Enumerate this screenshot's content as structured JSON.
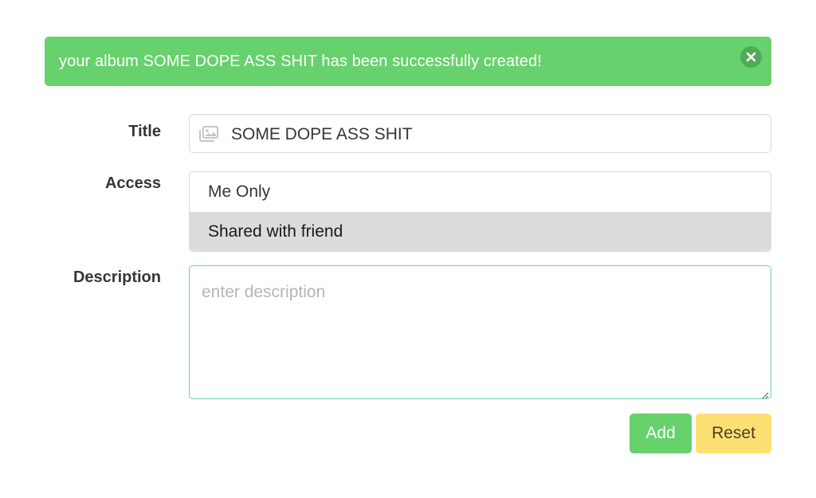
{
  "notification": {
    "message": "your album SOME DOPE ASS SHIT has been successfully created!",
    "close_icon": "close-icon",
    "color": "#67d16d"
  },
  "form": {
    "title": {
      "label": "Title",
      "value": "SOME DOPE ASS SHIT",
      "icon": "images-icon"
    },
    "access": {
      "label": "Access",
      "options": [
        "Me Only",
        "Shared with friend"
      ],
      "selected": "Shared with friend"
    },
    "description": {
      "label": "Description",
      "placeholder": "enter description",
      "value": ""
    }
  },
  "actions": {
    "add_label": "Add",
    "reset_label": "Reset",
    "add_color": "#67d16d",
    "reset_color": "#fde074"
  }
}
